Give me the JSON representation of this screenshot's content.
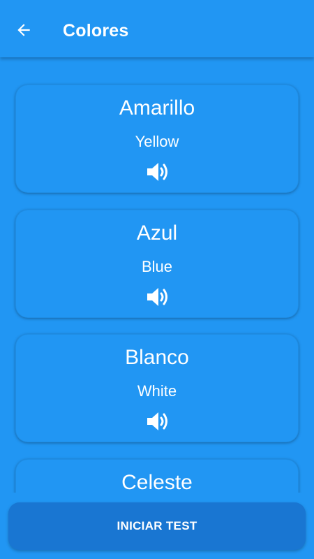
{
  "header": {
    "title": "Colores",
    "back_icon": "arrow-left-icon"
  },
  "colors": {
    "background": "#2196F3",
    "button": "#1976D2",
    "text": "#FFFFFF"
  },
  "cards": [
    {
      "word": "Amarillo",
      "translation": "Yellow",
      "icon": "speaker-icon"
    },
    {
      "word": "Azul",
      "translation": "Blue",
      "icon": "speaker-icon"
    },
    {
      "word": "Blanco",
      "translation": "White",
      "icon": "speaker-icon"
    },
    {
      "word": "Celeste",
      "translation": "",
      "icon": "speaker-icon"
    }
  ],
  "footer": {
    "button_label": "INICIAR TEST"
  }
}
